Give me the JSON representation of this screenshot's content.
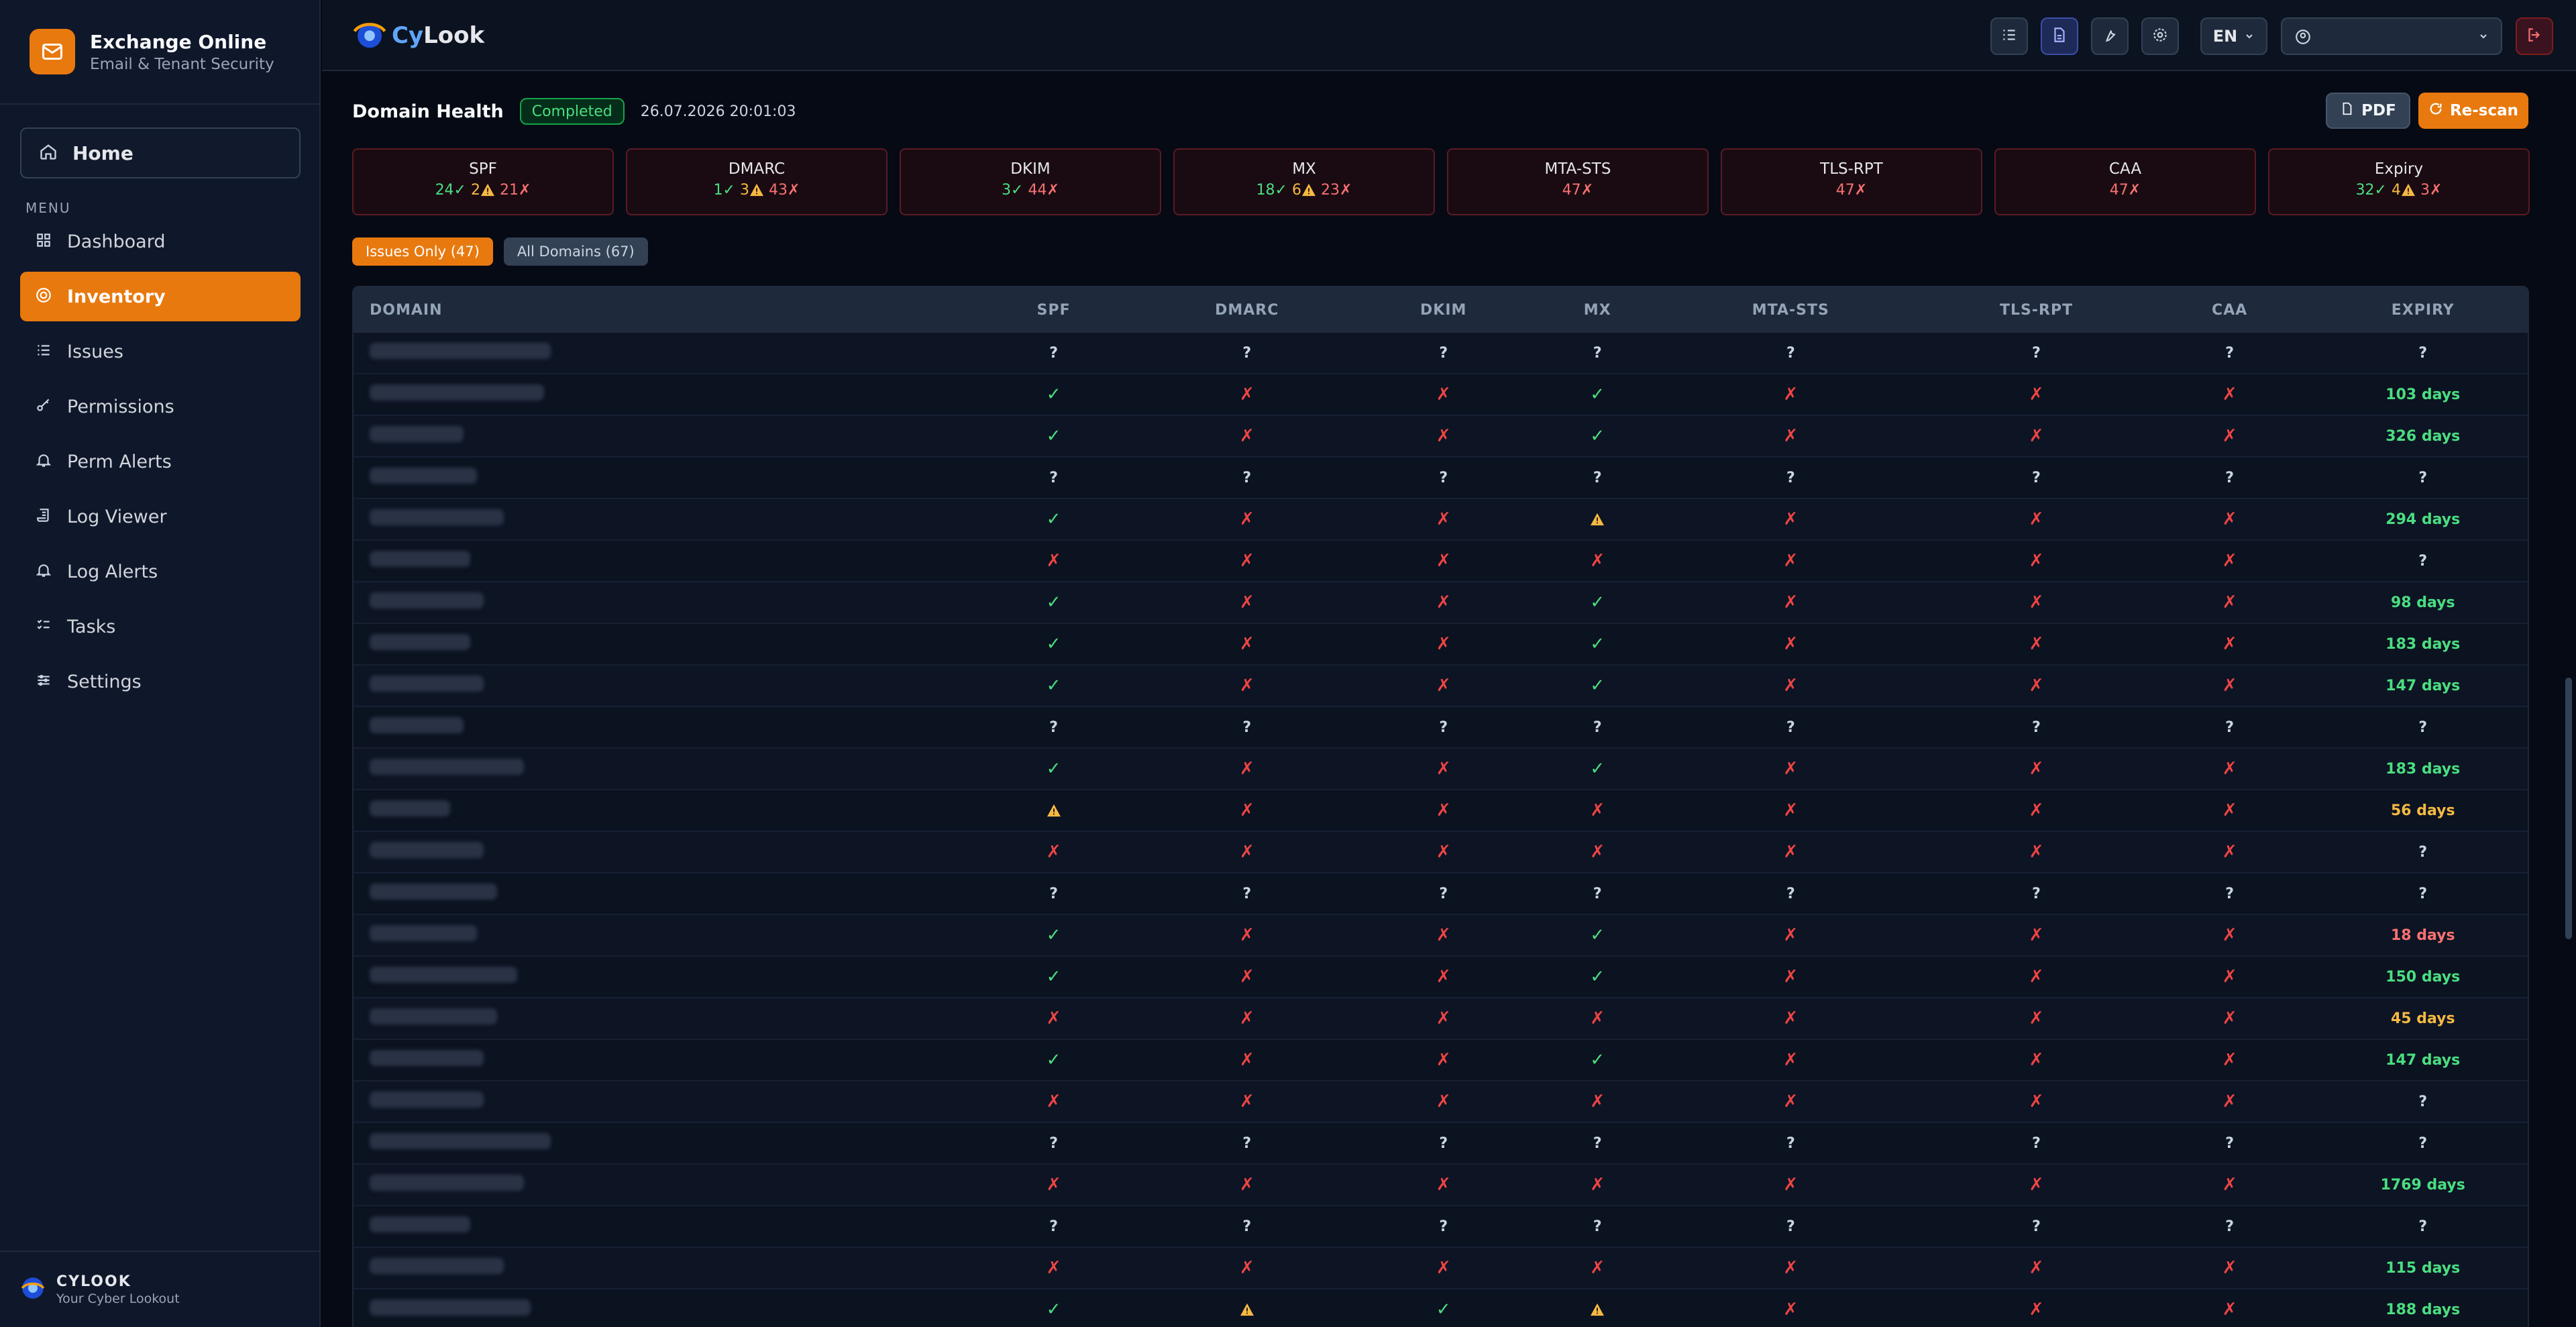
{
  "sidebar": {
    "app_title": "Exchange Online",
    "app_subtitle": "Email & Tenant Security",
    "home_label": "Home",
    "menu_heading": "MENU",
    "items": [
      {
        "label": "Dashboard",
        "icon": "grid-icon"
      },
      {
        "label": "Inventory",
        "icon": "target-icon",
        "active": true
      },
      {
        "label": "Issues",
        "icon": "list-icon"
      },
      {
        "label": "Permissions",
        "icon": "key-icon"
      },
      {
        "label": "Perm Alerts",
        "icon": "bell-icon"
      },
      {
        "label": "Log Viewer",
        "icon": "scroll-icon"
      },
      {
        "label": "Log Alerts",
        "icon": "bell-icon"
      },
      {
        "label": "Tasks",
        "icon": "task-list-icon"
      },
      {
        "label": "Settings",
        "icon": "sliders-icon"
      }
    ],
    "footer_title": "CYLOOK",
    "footer_sub": "Your Cyber Lookout"
  },
  "topbar": {
    "logo_cy": "Cy",
    "logo_look": "Look",
    "language": "EN",
    "user_value": ""
  },
  "page": {
    "title": "Domain Health",
    "status": "Completed",
    "timestamp": "26.07.2026 20:01:03",
    "pdf_label": "PDF",
    "rescan_label": "Re-scan"
  },
  "summary": [
    {
      "name": "SPF",
      "ok": "24✓",
      "warn": "2",
      "fail": "21✗"
    },
    {
      "name": "DMARC",
      "ok": "1✓",
      "warn": "3",
      "fail": "43✗"
    },
    {
      "name": "DKIM",
      "ok": "3✓",
      "warn": "",
      "fail": "44✗"
    },
    {
      "name": "MX",
      "ok": "18✓",
      "warn": "6",
      "fail": "23✗"
    },
    {
      "name": "MTA-STS",
      "ok": "",
      "warn": "",
      "fail": "47✗"
    },
    {
      "name": "TLS-RPT",
      "ok": "",
      "warn": "",
      "fail": "47✗"
    },
    {
      "name": "CAA",
      "ok": "",
      "warn": "",
      "fail": "47✗"
    },
    {
      "name": "Expiry",
      "ok": "32✓",
      "warn": "4",
      "fail": "3✗"
    }
  ],
  "filters": {
    "issues_only": "Issues Only (47)",
    "all_domains": "All Domains (67)"
  },
  "table": {
    "columns": [
      "DOMAIN",
      "SPF",
      "DMARC",
      "DKIM",
      "MX",
      "MTA-STS",
      "TLS-RPT",
      "CAA",
      "EXPIRY"
    ],
    "rows": [
      [
        "?",
        "?",
        "?",
        "?",
        "?",
        "?",
        "?",
        "?"
      ],
      [
        "ok",
        "bad",
        "bad",
        "ok",
        "bad",
        "bad",
        "bad",
        "103 days"
      ],
      [
        "ok",
        "bad",
        "bad",
        "ok",
        "bad",
        "bad",
        "bad",
        "326 days"
      ],
      [
        "?",
        "?",
        "?",
        "?",
        "?",
        "?",
        "?",
        "?"
      ],
      [
        "ok",
        "bad",
        "bad",
        "warn",
        "bad",
        "bad",
        "bad",
        "294 days"
      ],
      [
        "bad",
        "bad",
        "bad",
        "bad",
        "bad",
        "bad",
        "bad",
        "?"
      ],
      [
        "ok",
        "bad",
        "bad",
        "ok",
        "bad",
        "bad",
        "bad",
        "98 days"
      ],
      [
        "ok",
        "bad",
        "bad",
        "ok",
        "bad",
        "bad",
        "bad",
        "183 days"
      ],
      [
        "ok",
        "bad",
        "bad",
        "ok",
        "bad",
        "bad",
        "bad",
        "147 days"
      ],
      [
        "?",
        "?",
        "?",
        "?",
        "?",
        "?",
        "?",
        "?"
      ],
      [
        "ok",
        "bad",
        "bad",
        "ok",
        "bad",
        "bad",
        "bad",
        "183 days"
      ],
      [
        "warn",
        "bad",
        "bad",
        "bad",
        "bad",
        "bad",
        "bad",
        "56 days"
      ],
      [
        "bad",
        "bad",
        "bad",
        "bad",
        "bad",
        "bad",
        "bad",
        "?"
      ],
      [
        "?",
        "?",
        "?",
        "?",
        "?",
        "?",
        "?",
        "?"
      ],
      [
        "ok",
        "bad",
        "bad",
        "ok",
        "bad",
        "bad",
        "bad",
        "18 days"
      ],
      [
        "ok",
        "bad",
        "bad",
        "ok",
        "bad",
        "bad",
        "bad",
        "150 days"
      ],
      [
        "bad",
        "bad",
        "bad",
        "bad",
        "bad",
        "bad",
        "bad",
        "45 days"
      ],
      [
        "ok",
        "bad",
        "bad",
        "ok",
        "bad",
        "bad",
        "bad",
        "147 days"
      ],
      [
        "bad",
        "bad",
        "bad",
        "bad",
        "bad",
        "bad",
        "bad",
        "?"
      ],
      [
        "?",
        "?",
        "?",
        "?",
        "?",
        "?",
        "?",
        "?"
      ],
      [
        "bad",
        "bad",
        "bad",
        "bad",
        "bad",
        "bad",
        "bad",
        "1769 days"
      ],
      [
        "?",
        "?",
        "?",
        "?",
        "?",
        "?",
        "?",
        "?"
      ],
      [
        "bad",
        "bad",
        "bad",
        "bad",
        "bad",
        "bad",
        "bad",
        "115 days"
      ],
      [
        "ok",
        "warn",
        "ok",
        "warn",
        "bad",
        "bad",
        "bad",
        "188 days"
      ]
    ],
    "expiry_colors": {
      "103 days": "#4ade80",
      "326 days": "#4ade80",
      "294 days": "#4ade80",
      "98 days": "#4ade80",
      "183 days": "#4ade80",
      "147 days": "#4ade80",
      "56 days": "#f5b942",
      "18 days": "#f87171",
      "150 days": "#4ade80",
      "45 days": "#f5b942",
      "1769 days": "#4ade80",
      "115 days": "#4ade80",
      "188 days": "#4ade80"
    }
  },
  "colors": {
    "accent": "#e8790e",
    "ok": "#4ade80",
    "warn": "#f5b942",
    "fail": "#ef4444"
  }
}
